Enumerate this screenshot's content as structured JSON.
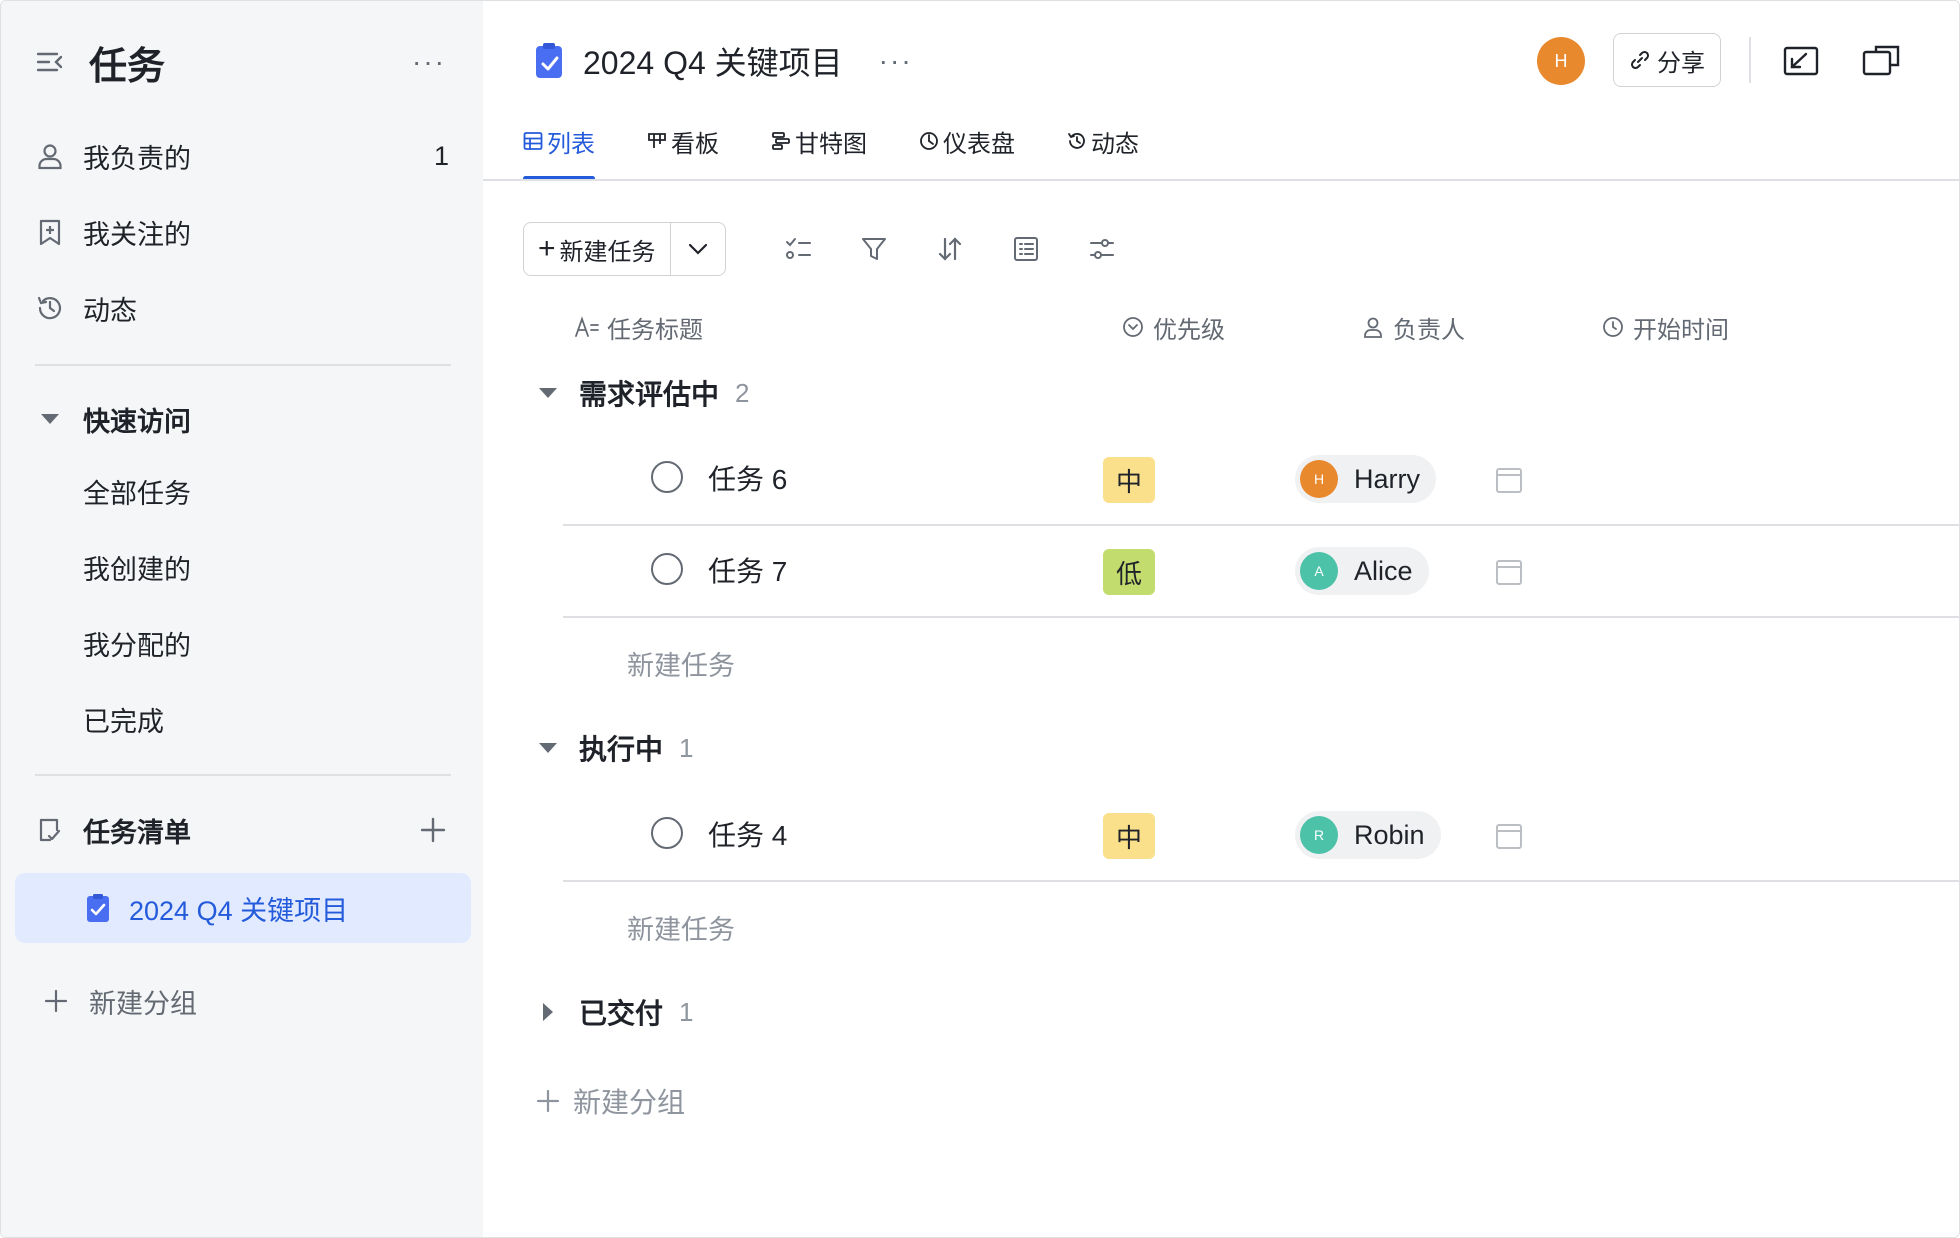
{
  "sidebar": {
    "title": "任务",
    "more": "···",
    "items": [
      {
        "label": "我负责的",
        "count": "1",
        "icon": "user-icon"
      },
      {
        "label": "我关注的",
        "icon": "bookmark-icon"
      },
      {
        "label": "动态",
        "icon": "history-icon"
      }
    ],
    "quick_access": {
      "label": "快速访问",
      "items": [
        "全部任务",
        "我创建的",
        "我分配的",
        "已完成"
      ]
    },
    "task_lists": {
      "label": "任务清单",
      "active": "2024 Q4 关键项目"
    },
    "new_group": "新建分组"
  },
  "header": {
    "project_title": "2024 Q4 关键项目",
    "more": "···",
    "avatar_initial": "H",
    "share_label": "分享"
  },
  "tabs": [
    {
      "label": "列表",
      "icon": "table-icon",
      "active": true
    },
    {
      "label": "看板",
      "icon": "kanban-icon",
      "active": false
    },
    {
      "label": "甘特图",
      "icon": "gantt-icon",
      "active": false
    },
    {
      "label": "仪表盘",
      "icon": "dashboard-icon",
      "active": false
    },
    {
      "label": "动态",
      "icon": "history-icon",
      "active": false
    }
  ],
  "toolbar": {
    "new_task": "新建任务"
  },
  "columns": {
    "title": "任务标题",
    "priority": "优先级",
    "owner": "负责人",
    "start": "开始时间"
  },
  "groups": [
    {
      "name": "需求评估中",
      "count": "2",
      "expanded": true,
      "tasks": [
        {
          "name": "任务 6",
          "priority": "中",
          "owner": "Harry",
          "initial": "H"
        },
        {
          "name": "任务 7",
          "priority": "低",
          "owner": "Alice",
          "initial": "A"
        }
      ],
      "add_label": "新建任务"
    },
    {
      "name": "执行中",
      "count": "1",
      "expanded": true,
      "tasks": [
        {
          "name": "任务 4",
          "priority": "中",
          "owner": "Robin",
          "initial": "R"
        }
      ],
      "add_label": "新建任务"
    },
    {
      "name": "已交付",
      "count": "1",
      "expanded": false
    }
  ],
  "new_group": "新建分组",
  "colors": {
    "accent": "#245bdb",
    "priority_mid": "#fbe08b",
    "priority_low": "#c3dc6e",
    "avatar_harry": "#e8892e",
    "avatar_alice": "#4cc2a8",
    "avatar_robin": "#4cc2a8"
  }
}
